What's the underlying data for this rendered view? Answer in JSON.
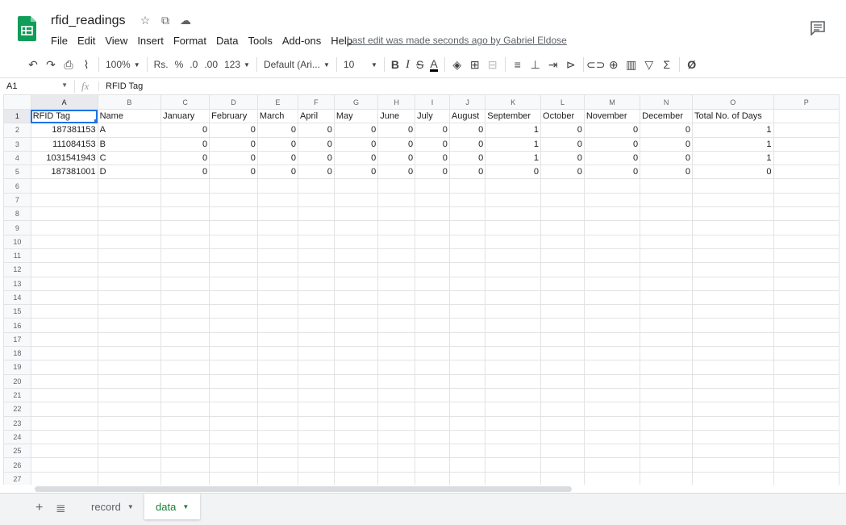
{
  "doc": {
    "title": "rfid_readings",
    "last_edit": "Last edit was made seconds ago by Gabriel Eldose"
  },
  "menu": [
    "File",
    "Edit",
    "View",
    "Insert",
    "Format",
    "Data",
    "Tools",
    "Add-ons",
    "Help"
  ],
  "toolbar": {
    "zoom": "100%",
    "currency": "Rs.",
    "percent": "%",
    "dec_less": ".0",
    "dec_more": ".00",
    "more_formats": "123",
    "font": "Default (Ari...",
    "font_size": "10",
    "bold": "B",
    "italic": "I",
    "strike": "S",
    "text_color": "A"
  },
  "formula_bar": {
    "cell_ref": "A1",
    "value": "RFID Tag"
  },
  "grid": {
    "columns": [
      "A",
      "B",
      "C",
      "D",
      "E",
      "F",
      "G",
      "H",
      "I",
      "J",
      "K",
      "L",
      "M",
      "N",
      "O",
      "P"
    ],
    "row_count": 27,
    "header_row": [
      "RFID Tag",
      "Name",
      "January",
      "February",
      "March",
      "April",
      "May",
      "June",
      "July",
      "August",
      "September",
      "October",
      "November",
      "December",
      "Total No. of Days"
    ],
    "data_rows": [
      [
        "187381153",
        "A",
        "0",
        "0",
        "0",
        "0",
        "0",
        "0",
        "0",
        "0",
        "1",
        "0",
        "0",
        "0",
        "1"
      ],
      [
        "111084153",
        "B",
        "0",
        "0",
        "0",
        "0",
        "0",
        "0",
        "0",
        "0",
        "1",
        "0",
        "0",
        "0",
        "1"
      ],
      [
        "1031541943",
        "C",
        "0",
        "0",
        "0",
        "0",
        "0",
        "0",
        "0",
        "0",
        "1",
        "0",
        "0",
        "0",
        "1"
      ],
      [
        "187381001",
        "D",
        "0",
        "0",
        "0",
        "0",
        "0",
        "0",
        "0",
        "0",
        "0",
        "0",
        "0",
        "0",
        "0"
      ]
    ]
  },
  "sheets": [
    {
      "name": "record",
      "active": false
    },
    {
      "name": "data",
      "active": true
    }
  ],
  "colors": {
    "accent": "#1a73e8",
    "sheets_green": "#188038",
    "logo_green": "#0f9d58"
  }
}
